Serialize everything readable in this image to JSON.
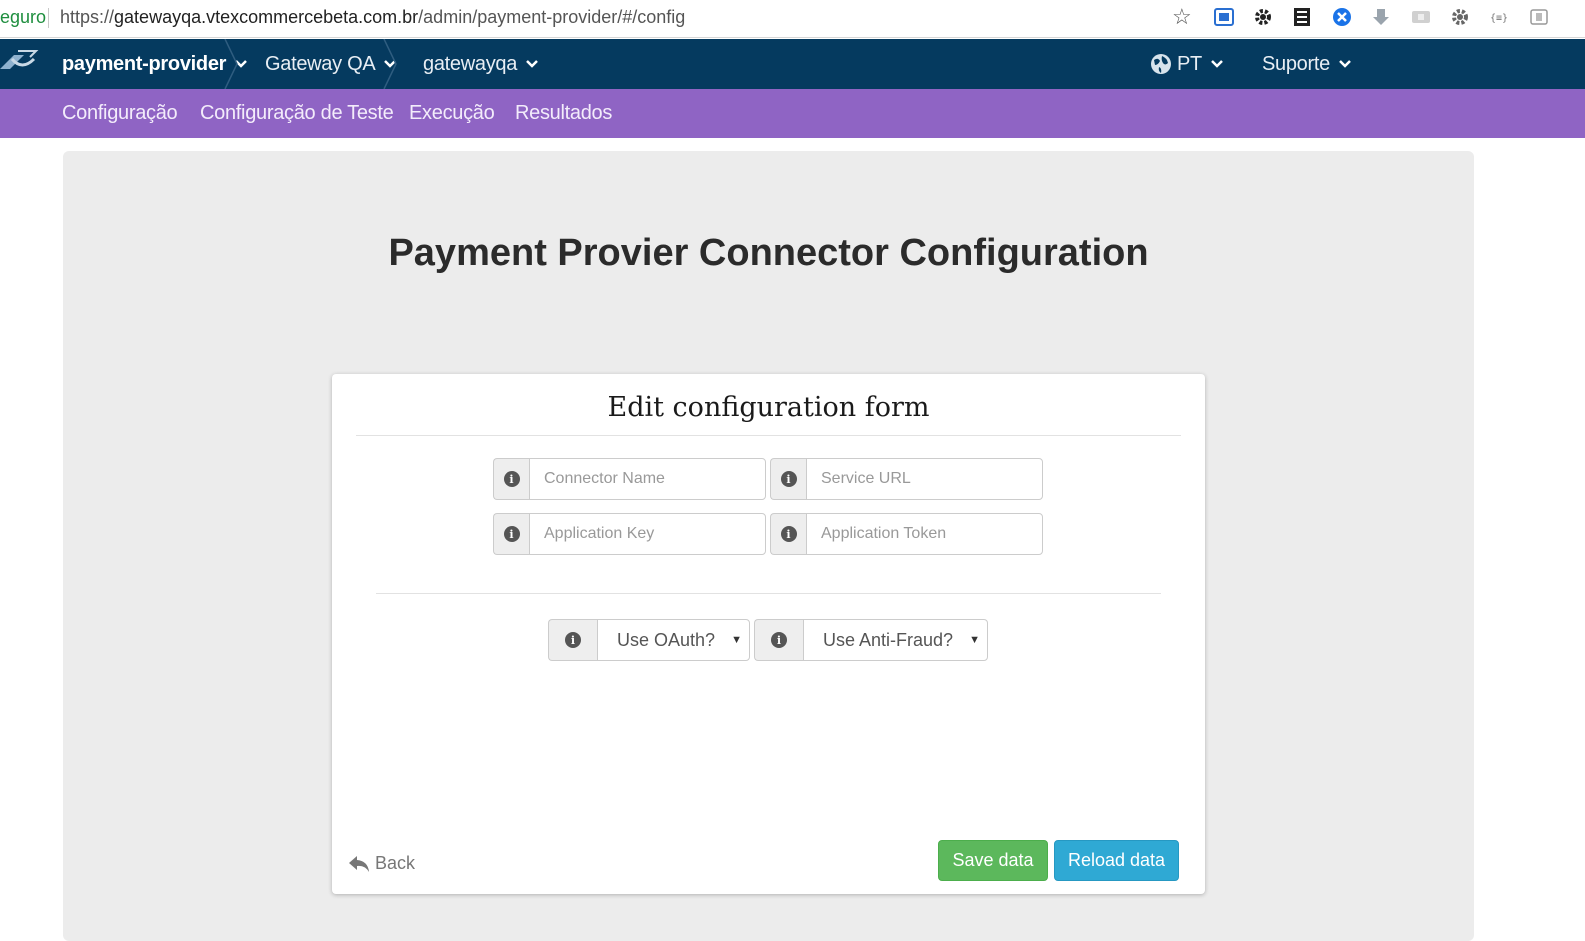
{
  "browser": {
    "security_label": "eguro",
    "url_scheme": "https://",
    "url_host": "gatewayqa.vtexcommercebeta.com.br",
    "url_path": "/admin/payment-provider/#/config"
  },
  "topnav": {
    "breadcrumbs": [
      "payment-provider",
      "Gateway QA",
      "gatewayqa"
    ],
    "language": "PT",
    "support": "Suporte"
  },
  "subnav": {
    "items": [
      "Configuração",
      "Configuração de Teste",
      "Execução",
      "Resultados"
    ]
  },
  "main": {
    "title": "Payment Provier Connector Configuration"
  },
  "form": {
    "title": "Edit configuration form",
    "fields": {
      "connector_name": {
        "placeholder": "Connector Name",
        "value": ""
      },
      "service_url": {
        "placeholder": "Service URL",
        "value": ""
      },
      "application_key": {
        "placeholder": "Application Key",
        "value": ""
      },
      "application_token": {
        "placeholder": "Application Token",
        "value": ""
      }
    },
    "selects": {
      "oauth": "Use OAuth?",
      "antifraud": "Use Anti-Fraud?"
    },
    "info_glyph": "i",
    "back_label": "Back",
    "save_label": "Save data",
    "reload_label": "Reload data"
  },
  "colors": {
    "topnav_bg": "#053a5f",
    "subnav_bg": "#8f64c4",
    "save_btn": "#5cb85c",
    "reload_btn": "#2fa9d4"
  }
}
